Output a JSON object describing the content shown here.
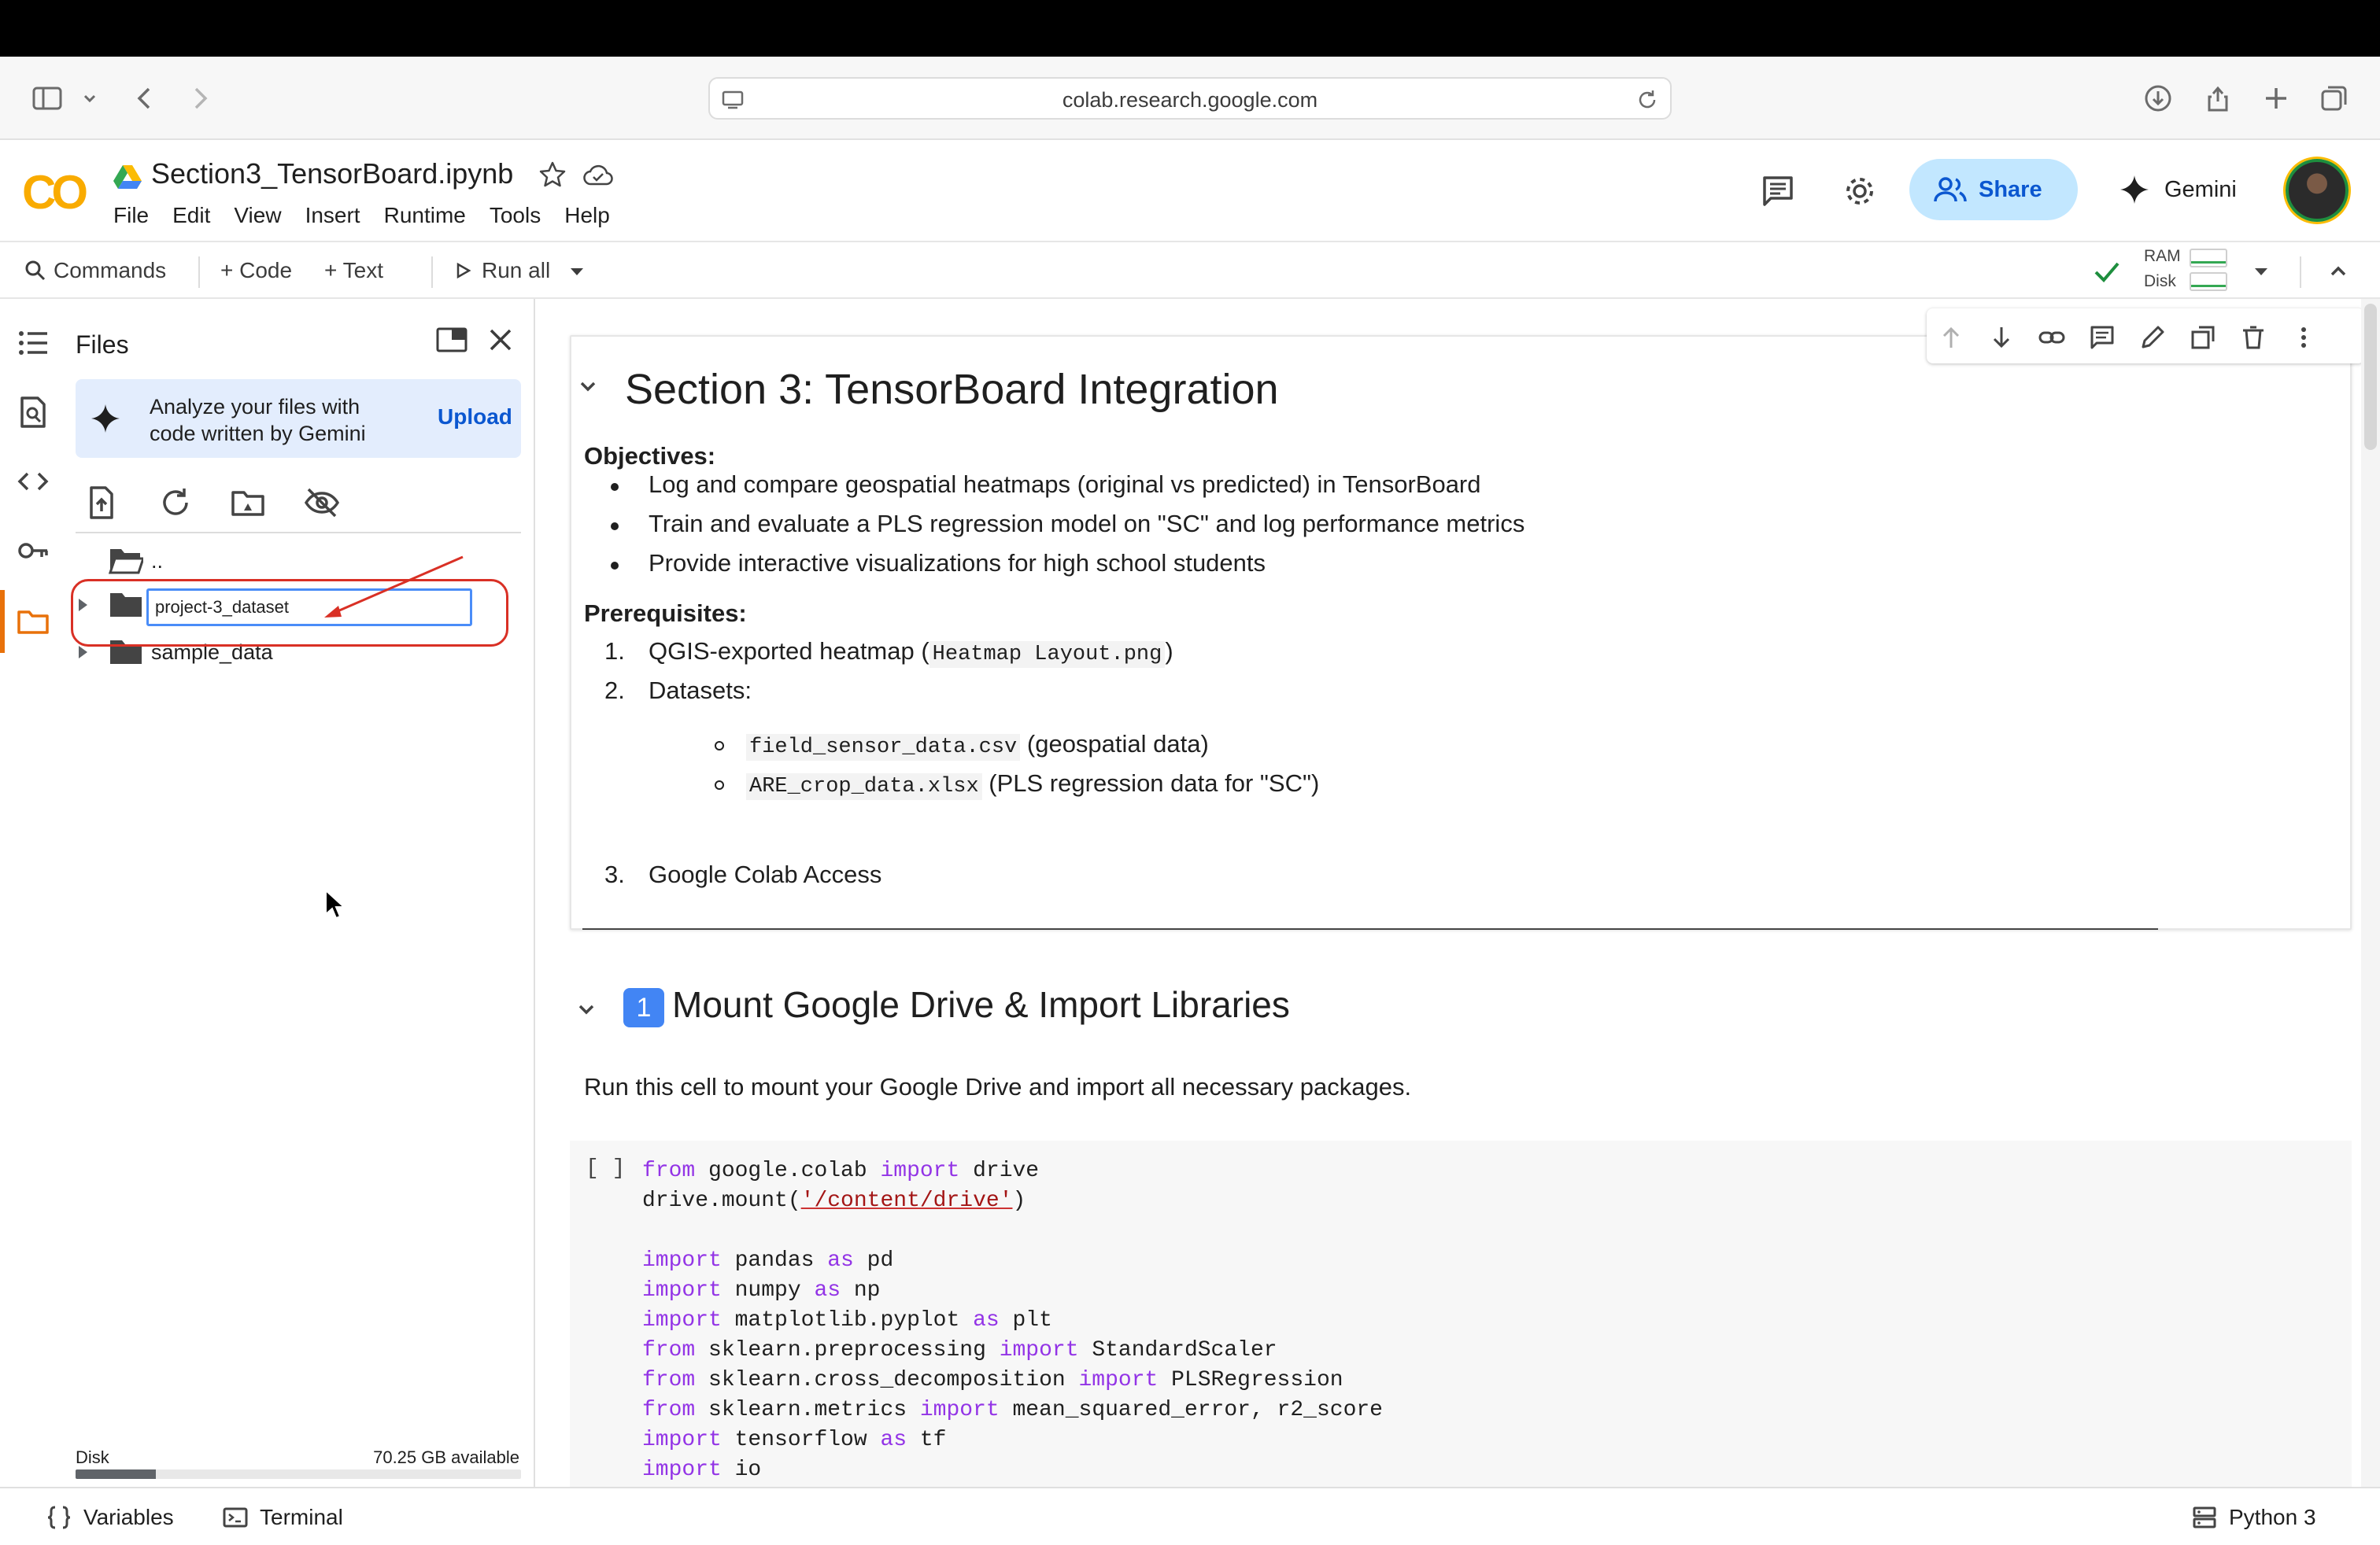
{
  "browser": {
    "url": "colab.research.google.com"
  },
  "header": {
    "logo": "CO",
    "notebook_title": "Section3_TensorBoard.ipynb",
    "menu": [
      "File",
      "Edit",
      "View",
      "Insert",
      "Runtime",
      "Tools",
      "Help"
    ],
    "share_label": "Share",
    "gemini_label": "Gemini"
  },
  "toolbar": {
    "commands_label": "Commands",
    "code_label": "+ Code",
    "text_label": "+ Text",
    "run_all_label": "Run all",
    "ram_label": "RAM",
    "disk_label": "Disk"
  },
  "files_panel": {
    "title": "Files",
    "gemini_card_text": "Analyze your files with code written by Gemini",
    "upload_label": "Upload",
    "parent_folder_label": "..",
    "rename_value": "project-3_dataset",
    "folders": [
      "sample_data"
    ],
    "disk_label": "Disk",
    "disk_available": "70.25 GB available",
    "disk_used_fraction": 0.18
  },
  "notebook": {
    "section3": {
      "heading": "Section 3: TensorBoard Integration",
      "objectives_label": "Objectives:",
      "objectives": [
        "Log and compare geospatial heatmaps (original vs predicted) in TensorBoard",
        "Train and evaluate a PLS regression model on \"SC\" and log performance metrics",
        "Provide interactive visualizations for high school students"
      ],
      "prerequisites_label": "Prerequisites:",
      "prereq1_prefix": "QGIS-exported heatmap (",
      "prereq1_code": "Heatmap Layout.png",
      "prereq1_suffix": ")",
      "prereq2": "Datasets:",
      "dataset1_code": "field_sensor_data.csv",
      "dataset1_desc": "(geospatial data)",
      "dataset2_code": "ARE_crop_data.xlsx",
      "dataset2_desc": "(PLS regression data for \"SC\")",
      "prereq3": "Google Colab Access",
      "numbers": [
        "1.",
        "2.",
        "3."
      ]
    },
    "section1": {
      "keycap": "1",
      "heading": "Mount Google Drive & Import Libraries",
      "description": "Run this cell to mount your Google Drive and import all necessary packages."
    },
    "code_cell": {
      "run_indicator": "[ ]"
    }
  },
  "statusbar": {
    "variables_label": "Variables",
    "terminal_label": "Terminal",
    "runtime_label": "Python 3"
  }
}
